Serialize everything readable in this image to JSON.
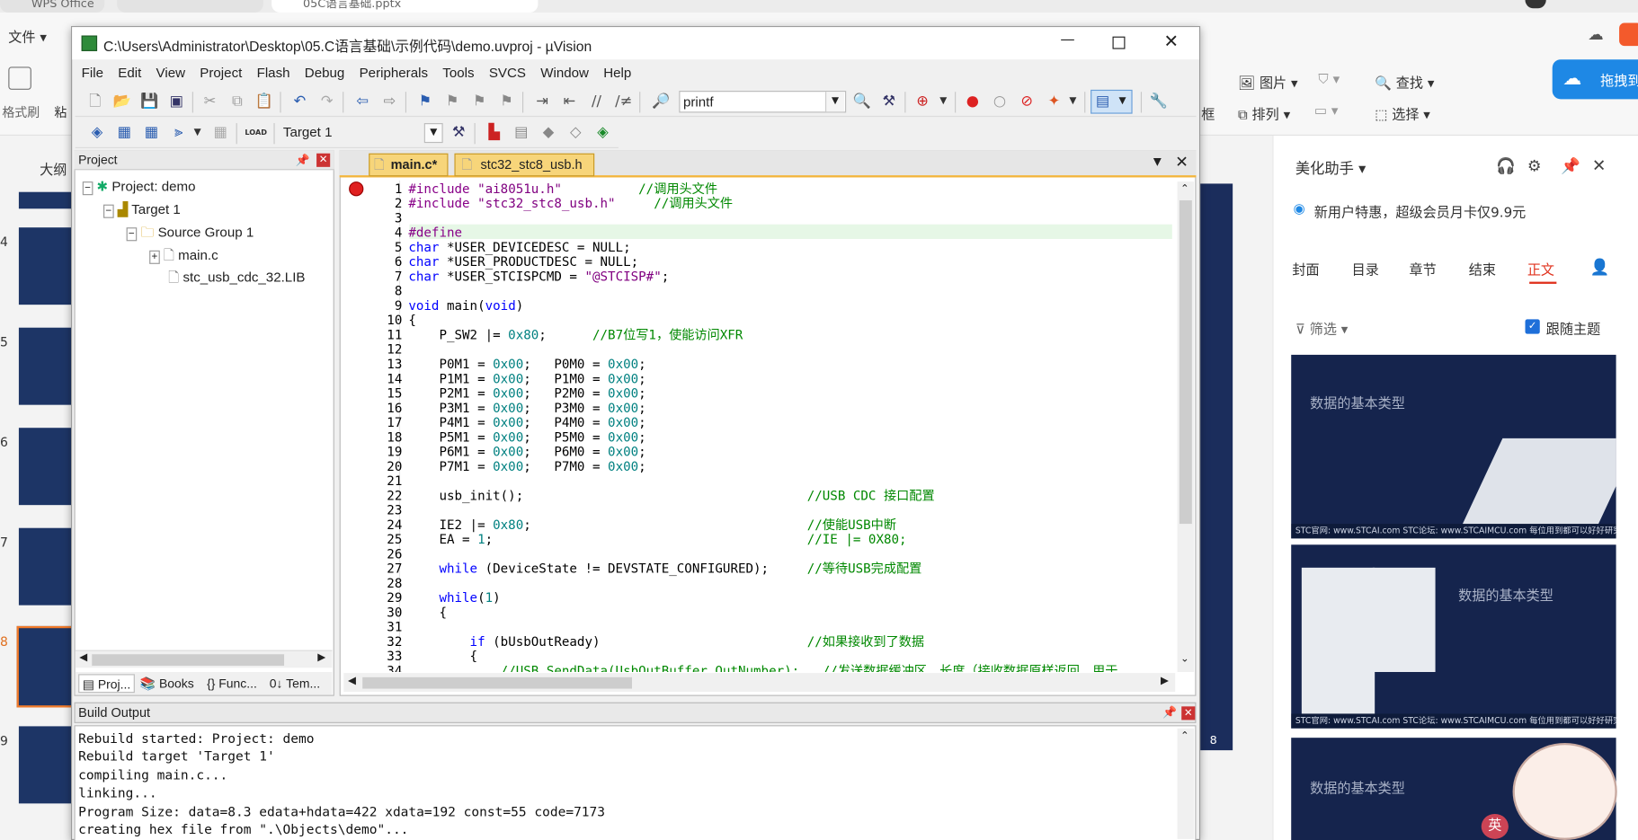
{
  "browser_tabs": [
    "WPS Office",
    "",
    "05C语言基础.pptx"
  ],
  "wps": {
    "file_menu": "文件",
    "ribbon_left": [
      "格式刷",
      "粘"
    ],
    "ribbon_right": {
      "picture": "图片",
      "find": "查找",
      "frame": "框",
      "arrange": "排列",
      "select": "选择",
      "promo": "拖拽到"
    },
    "outline_tab": "大纲",
    "slide_numbers": [
      "4",
      "5",
      "6",
      "7",
      "8",
      "9"
    ],
    "slide_page_number": "8"
  },
  "uvision": {
    "title": "C:\\Users\\Administrator\\Desktop\\05.C语言基础\\示例代码\\demo.uvproj - µVision",
    "menu": [
      "File",
      "Edit",
      "View",
      "Project",
      "Flash",
      "Debug",
      "Peripherals",
      "Tools",
      "SVCS",
      "Window",
      "Help"
    ],
    "find_combo": "printf",
    "target_combo": "Target 1",
    "load_label": "LOAD",
    "project_panel": {
      "title": "Project",
      "tree": [
        "Project: demo",
        "Target 1",
        "Source Group 1",
        "main.c",
        "stc_usb_cdc_32.LIB"
      ],
      "bottom_tabs": [
        "Proj...",
        "Books",
        "{} Func...",
        "0↓ Tem..."
      ]
    },
    "editor_tabs": [
      "main.c*",
      "stc32_stc8_usb.h"
    ],
    "code_lines": [
      {
        "n": "1",
        "t": "#include \"ai8051u.h\"          //调用头文件"
      },
      {
        "n": "2",
        "t": "#include \"stc32_stc8_usb.h\"     //调用头文件"
      },
      {
        "n": "3",
        "t": ""
      },
      {
        "n": "4",
        "t": "#define"
      },
      {
        "n": "5",
        "t": "char *USER_DEVICEDESC = NULL;"
      },
      {
        "n": "6",
        "t": "char *USER_PRODUCTDESC = NULL;"
      },
      {
        "n": "7",
        "t": "char *USER_STCISPCMD = \"@STCISP#\";"
      },
      {
        "n": "8",
        "t": ""
      },
      {
        "n": "9",
        "t": "void main(void)"
      },
      {
        "n": "10",
        "t": "{"
      },
      {
        "n": "11",
        "t": "    P_SW2 |= 0x80;      //B7位写1，使能访问XFR"
      },
      {
        "n": "12",
        "t": ""
      },
      {
        "n": "13",
        "t": "    P0M1 = 0x00;   P0M0 = 0x00;"
      },
      {
        "n": "14",
        "t": "    P1M1 = 0x00;   P1M0 = 0x00;"
      },
      {
        "n": "15",
        "t": "    P2M1 = 0x00;   P2M0 = 0x00;"
      },
      {
        "n": "16",
        "t": "    P3M1 = 0x00;   P3M0 = 0x00;"
      },
      {
        "n": "17",
        "t": "    P4M1 = 0x00;   P4M0 = 0x00;"
      },
      {
        "n": "18",
        "t": "    P5M1 = 0x00;   P5M0 = 0x00;"
      },
      {
        "n": "19",
        "t": "    P6M1 = 0x00;   P6M0 = 0x00;"
      },
      {
        "n": "20",
        "t": "    P7M1 = 0x00;   P7M0 = 0x00;"
      },
      {
        "n": "21",
        "t": ""
      },
      {
        "n": "22",
        "t": "    usb_init();                                     //USB CDC 接口配置"
      },
      {
        "n": "23",
        "t": ""
      },
      {
        "n": "24",
        "t": "    IE2 |= 0x80;                                    //使能USB中断"
      },
      {
        "n": "25",
        "t": "    EA = 1;                                         //IE |= 0X80;"
      },
      {
        "n": "26",
        "t": ""
      },
      {
        "n": "27",
        "t": "    while (DeviceState != DEVSTATE_CONFIGURED);     //等待USB完成配置"
      },
      {
        "n": "28",
        "t": ""
      },
      {
        "n": "29",
        "t": "    while(1)"
      },
      {
        "n": "30",
        "t": "    {"
      },
      {
        "n": "31",
        "t": ""
      },
      {
        "n": "32",
        "t": "        if (bUsbOutReady)                           //如果接收到了数据"
      },
      {
        "n": "33",
        "t": "        {"
      },
      {
        "n": "34",
        "t": "            //USB_SendData(UsbOutBuffer,OutNumber);   //发送数据缓冲区，长度（接收数据原样返回，用于"
      }
    ],
    "build_output": {
      "title": "Build Output",
      "lines": [
        "Rebuild started: Project: demo",
        "Rebuild target 'Target 1'",
        "compiling main.c...",
        "linking...",
        "Program Size: data=8.3 edata+hdata=422 xdata=192 const=55 code=7173",
        "creating hex file from \".\\Objects\\demo\"..."
      ]
    }
  },
  "assistant": {
    "title": "美化助手",
    "promo": "新用户特惠，超级会员月卡仅9.9元",
    "tabs": [
      "封面",
      "目录",
      "章节",
      "结束",
      "正文"
    ],
    "active_tab": "正文",
    "filter": "筛选",
    "follow_theme": "跟随主题",
    "cards": [
      "数据的基本类型",
      "数据的基本类型",
      "数据的基本类型"
    ],
    "card_footer": "STC官网: www.STCAI.com    STC论坛: www.STCAIMCU.com    每位用到都可以好好研究",
    "ime_label": "英"
  },
  "colors": {
    "accent_red": "#e03030",
    "uv_blue": "#0000ff",
    "comment_green": "#008000",
    "wps_blue": "#1e88e5"
  }
}
